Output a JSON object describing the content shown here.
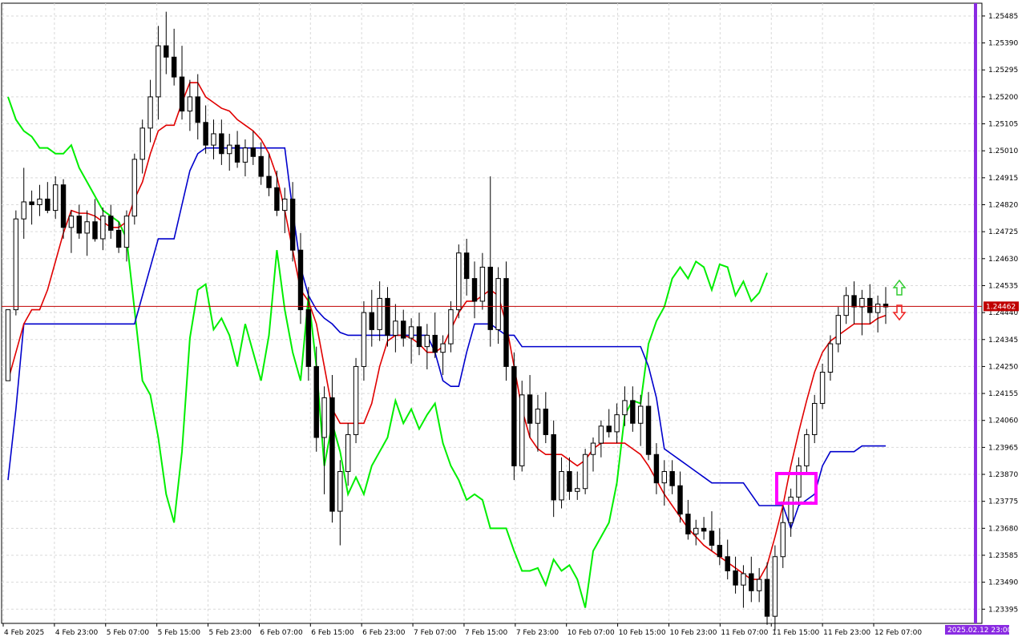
{
  "chart_data": {
    "type": "candlestick",
    "symbol_hint": "",
    "y_ticks": [
      "1.25485",
      "1.25390",
      "1.25295",
      "1.25200",
      "1.25105",
      "1.25010",
      "1.24915",
      "1.24820",
      "1.24725",
      "1.24630",
      "1.24535",
      "1.24440",
      "1.24345",
      "1.24250",
      "1.24155",
      "1.24060",
      "1.23965",
      "1.23870",
      "1.23775",
      "1.23680",
      "1.23585",
      "1.23490",
      "1.23395"
    ],
    "ylim": [
      1.23345,
      1.2553
    ],
    "x_ticks": [
      "4 Feb 2025",
      "4 Feb 23:00",
      "5 Feb 07:00",
      "5 Feb 15:00",
      "5 Feb 23:00",
      "6 Feb 07:00",
      "6 Feb 15:00",
      "6 Feb 23:00",
      "7 Feb 07:00",
      "7 Feb 15:00",
      "7 Feb 23:00",
      "10 Feb 07:00",
      "10 Feb 15:00",
      "10 Feb 23:00",
      "11 Feb 07:00",
      "11 Feb 15:00",
      "11 Feb 23:00",
      "12 Feb 07:00"
    ],
    "current_price": "1.24462",
    "current_price_value": 1.24462,
    "current_time_label": "2025.02.12 23:00",
    "colors": {
      "grid": "#d9d9d9",
      "price_line": "#c00000",
      "tenkan": "#e00000",
      "kijun": "#0000cc",
      "chikou": "#00ee00",
      "highlight_box": "#ff00ff",
      "time_marker": "#8a2be2",
      "arrow_up": "#33cc33",
      "arrow_down": "#ee2222"
    },
    "series": [
      {
        "key": "candles",
        "values": [
          [
            1.242,
            1.2445,
            1.2432,
            1.2445
          ],
          [
            1.2445,
            1.248,
            1.2443,
            1.2477
          ],
          [
            1.2477,
            1.2495,
            1.247,
            1.2483
          ],
          [
            1.2483,
            1.2487,
            1.2475,
            1.2482
          ],
          [
            1.2482,
            1.2489,
            1.2478,
            1.2484
          ],
          [
            1.2484,
            1.249,
            1.2479,
            1.248
          ],
          [
            1.248,
            1.2492,
            1.2477,
            1.2489
          ],
          [
            1.2489,
            1.2491,
            1.247,
            1.2474
          ],
          [
            1.2474,
            1.248,
            1.2465,
            1.2478
          ],
          [
            1.2478,
            1.2482,
            1.247,
            1.2472
          ],
          [
            1.2472,
            1.248,
            1.2464,
            1.2476
          ],
          [
            1.2476,
            1.2484,
            1.2469,
            1.247
          ],
          [
            1.247,
            1.2481,
            1.2466,
            1.2478
          ],
          [
            1.2478,
            1.2482,
            1.247,
            1.2473
          ],
          [
            1.2473,
            1.2476,
            1.2465,
            1.2467
          ],
          [
            1.2467,
            1.248,
            1.2462,
            1.2478
          ],
          [
            1.2478,
            1.25,
            1.2475,
            1.2498
          ],
          [
            1.2498,
            1.2512,
            1.2493,
            1.2509
          ],
          [
            1.2509,
            1.2526,
            1.2504,
            1.252
          ],
          [
            1.252,
            1.2545,
            1.2512,
            1.2538
          ],
          [
            1.2538,
            1.255,
            1.2528,
            1.2534
          ],
          [
            1.2534,
            1.2544,
            1.2524,
            1.2527
          ],
          [
            1.2527,
            1.2538,
            1.2512,
            1.2515
          ],
          [
            1.2515,
            1.2526,
            1.2508,
            1.252
          ],
          [
            1.252,
            1.2528,
            1.2505,
            1.2511
          ],
          [
            1.2511,
            1.2517,
            1.25,
            1.2503
          ],
          [
            1.2503,
            1.2512,
            1.2498,
            1.2507
          ],
          [
            1.2507,
            1.2512,
            1.2496,
            1.25
          ],
          [
            1.25,
            1.2507,
            1.2494,
            1.2503
          ],
          [
            1.2503,
            1.2508,
            1.2495,
            1.2497
          ],
          [
            1.2497,
            1.2505,
            1.2492,
            1.2502
          ],
          [
            1.2502,
            1.2508,
            1.2496,
            1.2499
          ],
          [
            1.2499,
            1.2504,
            1.2489,
            1.2492
          ],
          [
            1.2492,
            1.25,
            1.2485,
            1.2488
          ],
          [
            1.2488,
            1.2494,
            1.2478,
            1.248
          ],
          [
            1.248,
            1.2488,
            1.2472,
            1.2484
          ],
          [
            1.2484,
            1.249,
            1.2462,
            1.2466
          ],
          [
            1.2466,
            1.2472,
            1.244,
            1.2445
          ],
          [
            1.2445,
            1.2453,
            1.242,
            1.2425
          ],
          [
            1.2425,
            1.2432,
            1.2395,
            1.24
          ],
          [
            1.24,
            1.2418,
            1.238,
            1.2414
          ],
          [
            1.2414,
            1.2422,
            1.237,
            1.2374
          ],
          [
            1.2374,
            1.2392,
            1.2362,
            1.2388
          ],
          [
            1.2388,
            1.2405,
            1.2383,
            1.2401
          ],
          [
            1.2401,
            1.2428,
            1.2398,
            1.2425
          ],
          [
            1.2425,
            1.2448,
            1.242,
            1.2444
          ],
          [
            1.2444,
            1.2452,
            1.2432,
            1.2438
          ],
          [
            1.2438,
            1.2455,
            1.2434,
            1.2449
          ],
          [
            1.2449,
            1.2453,
            1.2432,
            1.2436
          ],
          [
            1.2436,
            1.2447,
            1.243,
            1.2441
          ],
          [
            1.2441,
            1.2445,
            1.2432,
            1.2435
          ],
          [
            1.2435,
            1.2442,
            1.2426,
            1.2439
          ],
          [
            1.2439,
            1.2444,
            1.2429,
            1.2432
          ],
          [
            1.2432,
            1.244,
            1.2424,
            1.2436
          ],
          [
            1.2436,
            1.2444,
            1.2428,
            1.243
          ],
          [
            1.243,
            1.2436,
            1.2422,
            1.2433
          ],
          [
            1.2433,
            1.2448,
            1.243,
            1.2445
          ],
          [
            1.2445,
            1.2468,
            1.2442,
            1.2465
          ],
          [
            1.2465,
            1.247,
            1.245,
            1.2456
          ],
          [
            1.2456,
            1.2462,
            1.2442,
            1.2448
          ],
          [
            1.2448,
            1.2465,
            1.2445,
            1.246
          ],
          [
            1.246,
            1.2492,
            1.2432,
            1.2438
          ],
          [
            1.2438,
            1.246,
            1.2433,
            1.2456
          ],
          [
            1.2456,
            1.2462,
            1.242,
            1.2425
          ],
          [
            1.2425,
            1.243,
            1.2385,
            1.239
          ],
          [
            1.239,
            1.242,
            1.2388,
            1.2415
          ],
          [
            1.2415,
            1.2422,
            1.24,
            1.2405
          ],
          [
            1.2405,
            1.2415,
            1.2395,
            1.241
          ],
          [
            1.241,
            1.2416,
            1.2398,
            1.2401
          ],
          [
            1.2401,
            1.2406,
            1.2372,
            1.2378
          ],
          [
            1.2378,
            1.2393,
            1.2375,
            1.2388
          ],
          [
            1.2388,
            1.2393,
            1.2378,
            1.2381
          ],
          [
            1.2381,
            1.2388,
            1.2378,
            1.2382
          ],
          [
            1.2382,
            1.2396,
            1.238,
            1.2394
          ],
          [
            1.2394,
            1.24,
            1.2388,
            1.2398
          ],
          [
            1.2398,
            1.2406,
            1.2393,
            1.2404
          ],
          [
            1.2404,
            1.241,
            1.24,
            1.2402
          ],
          [
            1.2402,
            1.2412,
            1.2398,
            1.2408
          ],
          [
            1.2408,
            1.2418,
            1.2404,
            1.2413
          ],
          [
            1.2413,
            1.2418,
            1.2402,
            1.2405
          ],
          [
            1.2405,
            1.2415,
            1.2397,
            1.2411
          ],
          [
            1.2411,
            1.2416,
            1.2392,
            1.2394
          ],
          [
            1.2394,
            1.2398,
            1.238,
            1.2384
          ],
          [
            1.2384,
            1.2392,
            1.2376,
            1.2388
          ],
          [
            1.2388,
            1.2392,
            1.238,
            1.2383
          ],
          [
            1.2383,
            1.2388,
            1.237,
            1.2373
          ],
          [
            1.2373,
            1.2378,
            1.2364,
            1.2366
          ],
          [
            1.2366,
            1.2371,
            1.2362,
            1.2368
          ],
          [
            1.2368,
            1.2372,
            1.2364,
            1.2367
          ],
          [
            1.2367,
            1.2374,
            1.236,
            1.2362
          ],
          [
            1.2362,
            1.2368,
            1.2355,
            1.2358
          ],
          [
            1.2358,
            1.2364,
            1.235,
            1.2353
          ],
          [
            1.2353,
            1.2358,
            1.2345,
            1.2348
          ],
          [
            1.2348,
            1.2355,
            1.234,
            1.2352
          ],
          [
            1.2352,
            1.2358,
            1.2342,
            1.2346
          ],
          [
            1.2346,
            1.2354,
            1.2342,
            1.235
          ],
          [
            1.235,
            1.2356,
            1.2334,
            1.2337
          ],
          [
            1.2337,
            1.2362,
            1.2332,
            1.2358
          ],
          [
            1.2358,
            1.2375,
            1.2354,
            1.237
          ],
          [
            1.237,
            1.2382,
            1.2365,
            1.2379
          ],
          [
            1.2379,
            1.2393,
            1.2376,
            1.239
          ],
          [
            1.239,
            1.2403,
            1.2387,
            1.2401
          ],
          [
            1.2401,
            1.2415,
            1.2398,
            1.2412
          ],
          [
            1.2412,
            1.2426,
            1.241,
            1.2423
          ],
          [
            1.2423,
            1.2436,
            1.242,
            1.2433
          ],
          [
            1.2433,
            1.2446,
            1.243,
            1.2443
          ],
          [
            1.2443,
            1.2453,
            1.244,
            1.245
          ],
          [
            1.245,
            1.2455,
            1.244,
            1.2446
          ],
          [
            1.2446,
            1.2452,
            1.2436,
            1.2449
          ],
          [
            1.2449,
            1.2454,
            1.244,
            1.2444
          ],
          [
            1.2444,
            1.245,
            1.2437,
            1.2447
          ],
          [
            1.2447,
            1.2453,
            1.244,
            1.2446
          ]
        ]
      },
      {
        "key": "tenkan",
        "values": [
          1.242,
          1.243,
          1.244,
          1.2445,
          1.2445,
          1.2452,
          1.2462,
          1.2472,
          1.248,
          1.2479,
          1.2479,
          1.2478,
          1.2476,
          1.2474,
          1.2474,
          1.2476,
          1.2484,
          1.249,
          1.25,
          1.2508,
          1.251,
          1.251,
          1.2518,
          1.2525,
          1.2525,
          1.252,
          1.2518,
          1.2516,
          1.2515,
          1.2512,
          1.251,
          1.2508,
          1.2505,
          1.25,
          1.2492,
          1.248,
          1.2466,
          1.2452,
          1.2448,
          1.244,
          1.2425,
          1.241,
          1.2405,
          1.2405,
          1.2405,
          1.2405,
          1.2412,
          1.2425,
          1.2434,
          1.2436,
          1.2436,
          1.2435,
          1.2433,
          1.243,
          1.243,
          1.2432,
          1.2438,
          1.2444,
          1.2448,
          1.2448,
          1.245,
          1.2452,
          1.245,
          1.244,
          1.2425,
          1.241,
          1.24,
          1.2396,
          1.2394,
          1.2394,
          1.2394,
          1.2392,
          1.239,
          1.2392,
          1.2396,
          1.2398,
          1.2398,
          1.2398,
          1.2398,
          1.2396,
          1.2394,
          1.239,
          1.2385,
          1.238,
          1.2376,
          1.2372,
          1.2368,
          1.2365,
          1.2362,
          1.236,
          1.2358,
          1.2356,
          1.2354,
          1.2352,
          1.235,
          1.235,
          1.2355,
          1.2365,
          1.2376,
          1.239,
          1.2402,
          1.2413,
          1.2423,
          1.243,
          1.2434,
          1.2436,
          1.2438,
          1.244,
          1.244,
          1.244,
          1.2442,
          1.2443
        ]
      },
      {
        "key": "kijun",
        "values": [
          1.2385,
          1.241,
          1.244,
          1.244,
          1.244,
          1.244,
          1.244,
          1.244,
          1.244,
          1.244,
          1.244,
          1.244,
          1.244,
          1.244,
          1.244,
          1.244,
          1.244,
          1.245,
          1.246,
          1.247,
          1.247,
          1.247,
          1.2482,
          1.2494,
          1.25,
          1.2502,
          1.2502,
          1.2502,
          1.2502,
          1.2502,
          1.2502,
          1.2502,
          1.2502,
          1.2502,
          1.2502,
          1.2502,
          1.248,
          1.246,
          1.245,
          1.2445,
          1.2442,
          1.244,
          1.2437,
          1.2436,
          1.2436,
          1.2436,
          1.2436,
          1.2436,
          1.2436,
          1.2436,
          1.2436,
          1.2436,
          1.2436,
          1.2436,
          1.243,
          1.242,
          1.2418,
          1.2418,
          1.243,
          1.244,
          1.244,
          1.244,
          1.2438,
          1.2436,
          1.2436,
          1.2432,
          1.2432,
          1.2432,
          1.2432,
          1.2432,
          1.2432,
          1.2432,
          1.2432,
          1.2432,
          1.2432,
          1.2432,
          1.2432,
          1.2432,
          1.2432,
          1.2432,
          1.2432,
          1.2425,
          1.2414,
          1.2396,
          1.2394,
          1.2392,
          1.239,
          1.2388,
          1.2386,
          1.2384,
          1.2384,
          1.2384,
          1.2384,
          1.2384,
          1.238,
          1.2376,
          1.2376,
          1.2376,
          1.2376,
          1.2368,
          1.2376,
          1.2378,
          1.238,
          1.239,
          1.2395,
          1.2395,
          1.2395,
          1.2395,
          1.2397,
          1.2397,
          1.2397,
          1.2397
        ]
      },
      {
        "key": "chikou",
        "values": [
          1.252,
          1.2512,
          1.2508,
          1.2506,
          1.2502,
          1.2502,
          1.25,
          1.25,
          1.2503,
          1.2495,
          1.249,
          1.2485,
          1.248,
          1.2478,
          1.2476,
          1.247,
          1.2445,
          1.242,
          1.2415,
          1.24,
          1.238,
          1.237,
          1.2395,
          1.2435,
          1.2452,
          1.2454,
          1.2438,
          1.2442,
          1.2436,
          1.2425,
          1.244,
          1.243,
          1.242,
          1.2436,
          1.2466,
          1.2445,
          1.243,
          1.242,
          1.245,
          1.2425,
          1.239,
          1.2405,
          1.2395,
          1.238,
          1.2386,
          1.238,
          1.239,
          1.2395,
          1.24,
          1.2413,
          1.2405,
          1.241,
          1.2403,
          1.2408,
          1.2412,
          1.2398,
          1.239,
          1.2385,
          1.2378,
          1.238,
          1.2378,
          1.2368,
          1.2368,
          1.2368,
          1.236,
          1.2353,
          1.2353,
          1.2354,
          1.2348,
          1.2357,
          1.2353,
          1.2355,
          1.235,
          1.234,
          1.236,
          1.2365,
          1.237,
          1.2384,
          1.2408,
          1.2413,
          1.2412,
          1.2433,
          1.2441,
          1.2446,
          1.2456,
          1.246,
          1.2456,
          1.2462,
          1.246,
          1.2452,
          1.2461,
          1.246,
          1.245,
          1.2455,
          1.2448,
          1.2451,
          1.2458
        ]
      }
    ]
  }
}
